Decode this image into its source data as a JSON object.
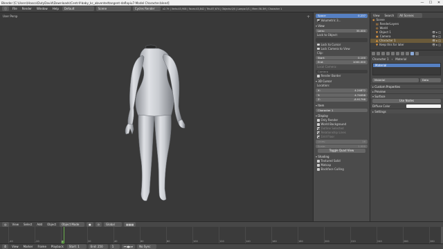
{
  "window": {
    "title": "Blender [C:\\Users\\Hasco\\DutyDavid\\Downloads\\Centrif-baby_kc_abventedtangent-daflapiu7-Model Character.blend]",
    "controls": [
      "—",
      "☐",
      "✕"
    ]
  },
  "infobar": {
    "menus": [
      "File",
      "Render",
      "Window",
      "Help"
    ],
    "layout": "Default",
    "scene": "Scene",
    "engine": "Cycles Render",
    "stats": "v2.79 | Verts:43,908 | Faces:43,842 | Tris:87,674 | Objects:0/4 | Lamps:0/1 | Mem:58.3M | Character 1"
  },
  "viewport": {
    "label": "User Persp",
    "object_label": "(1) Character 1",
    "corner_icon": "+"
  },
  "npanel": {
    "top_fields": [
      {
        "label": "Space",
        "value": "0.237"
      },
      {
        "label": "Space",
        "value": "0.000"
      }
    ],
    "top_checks": [
      "Volumetric 3...",
      "High Quality..."
    ],
    "view": {
      "header": "View",
      "lens_label": "Lens:",
      "lens_value": "35.000",
      "lock_to_object": "Lock to Object:",
      "lock_to_cursor": "Lock to Cursor",
      "lock_camera": "Lock Camera to View",
      "clip_label": "Clip:",
      "start_label": "Start:",
      "start_value": "0.100",
      "end_label": "End:",
      "end_value": "1000.000",
      "local_camera": "Local Camera:",
      "camera_field": "Camera",
      "render_border": "Render Border"
    },
    "cursor": {
      "header": "3D Cursor",
      "location": "Location:",
      "x": "4.24872",
      "y": "4.74058",
      "z": "-8.91798",
      "x_label": "X:",
      "y_label": "Y:",
      "z_label": "Z:"
    },
    "item": {
      "header": "Item",
      "name": "Character 1"
    },
    "display": {
      "header": "Display",
      "only_render": "Only Render",
      "world_background": "World Background",
      "outline_selected": "Outline Selected",
      "all_object_origins": "All Object Origins",
      "relationship_lines": "Relationship Lines",
      "grid_floor": "Grid Floor",
      "lines_label": "Lines:",
      "lines_value": "16",
      "scale_label": "Scale:",
      "scale_value": "1.000",
      "subdiv_label": "Subdivisions:",
      "subdiv_value": "10",
      "toggle_quad": "Toggle Quad View"
    },
    "shading": {
      "header": "Shading",
      "textured_solid": "Textured Solid",
      "matcap": "Matcap",
      "backface_culling": "Backface Culling"
    }
  },
  "outliner": {
    "menus": [
      "View",
      "Search"
    ],
    "filter": "All Scenes",
    "items": [
      {
        "name": "Scene",
        "indent": 0
      },
      {
        "name": "RenderLayers",
        "indent": 1
      },
      {
        "name": "World",
        "indent": 1
      },
      {
        "name": "Object 1",
        "indent": 1
      },
      {
        "name": "Camera",
        "indent": 1
      },
      {
        "name": "Character 1",
        "indent": 1,
        "selected": true
      },
      {
        "name": "Keep this for later",
        "indent": 1
      }
    ]
  },
  "props": {
    "crumb_object": "Character 1",
    "crumb_material": "Material",
    "slot_name": "Material",
    "material_field": "Material",
    "data_field": "Data",
    "panels": [
      "Custom Properties",
      "Preview",
      "Surface"
    ],
    "use_nodes": "Use Nodes",
    "diffuse_label": "Diffuse Color",
    "settings": "Settings"
  },
  "bottom": {
    "view_menus": [
      "View",
      "Select",
      "Add",
      "Object"
    ],
    "mode": "Object Mode",
    "pivot": "Global",
    "timeline_menus": [
      "View",
      "Marker",
      "Frame",
      "Playback"
    ],
    "start_label": "Start:",
    "start_value": "1",
    "end_label": "End:",
    "end_value": "250",
    "current_frame": "1",
    "sync": "No Sync",
    "frame_numbers": [
      "-40",
      "-20",
      "0",
      "20",
      "40",
      "60",
      "80",
      "100",
      "120",
      "140",
      "160",
      "180",
      "200",
      "220",
      "240",
      "260",
      "280"
    ]
  }
}
